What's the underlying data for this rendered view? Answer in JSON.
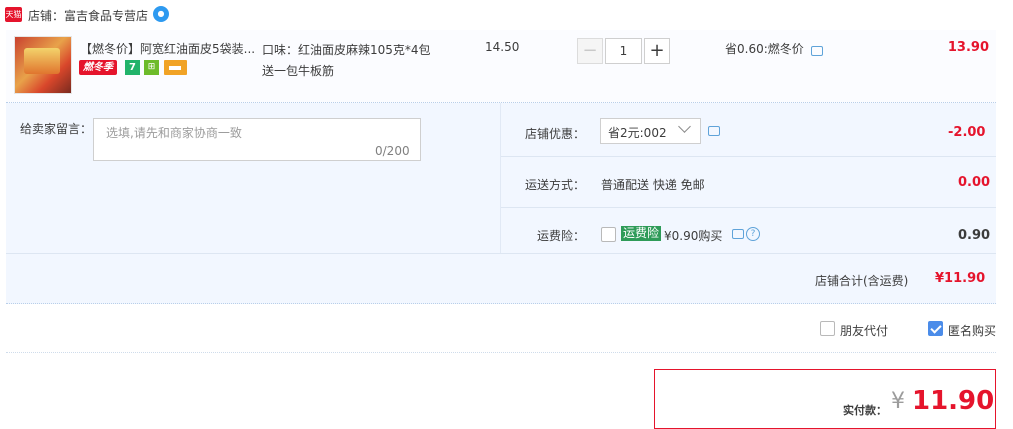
{
  "shop": {
    "badge": "天猫",
    "name": "店铺：富吉食品专营店",
    "ww_icon": "chat-bubble-icon"
  },
  "item": {
    "title": "【燃冬价】阿宽红油面皮5袋装...",
    "promo_tag": "燃冬季",
    "tag_seven": "7",
    "tag_b": "⊞",
    "spec_line1": "口味：红油面皮麻辣105克*4包",
    "spec_line2": "送一包牛板筋",
    "unit_price": "14.50",
    "qty_minus": "−",
    "quantity": "1",
    "qty_plus": "+",
    "save_note": "省0.60:燃冬价",
    "total": "13.90"
  },
  "message": {
    "label": "给卖家留言：",
    "placeholder": "选填,请先和商家协商一致",
    "count": "0/200"
  },
  "discount": {
    "label": "店铺优惠：",
    "selected": "省2元:002",
    "amount": "-2.00"
  },
  "shipping": {
    "label": "运送方式：",
    "value": "普通配送 快递 免邮",
    "amount": "0.00"
  },
  "insurance": {
    "label": "运费险：",
    "badge": "运费险",
    "price_text": "¥0.90购买",
    "help": "?",
    "amount": "0.90",
    "checked": false
  },
  "subtotal": {
    "label": "店铺合计(含运费)",
    "value": "¥11.90"
  },
  "options": {
    "friend_pay_label": "朋友代付",
    "friend_pay_checked": false,
    "anonymous_label": "匿名购买",
    "anonymous_checked": true
  },
  "payment": {
    "label": "实付款：",
    "currency": "¥",
    "amount": "11.90"
  },
  "colors": {
    "accent_red": "#e5142c",
    "link_blue": "#4b8ce9",
    "option_bg": "#f2f7ff",
    "insurance_green": "#2e9b58"
  }
}
